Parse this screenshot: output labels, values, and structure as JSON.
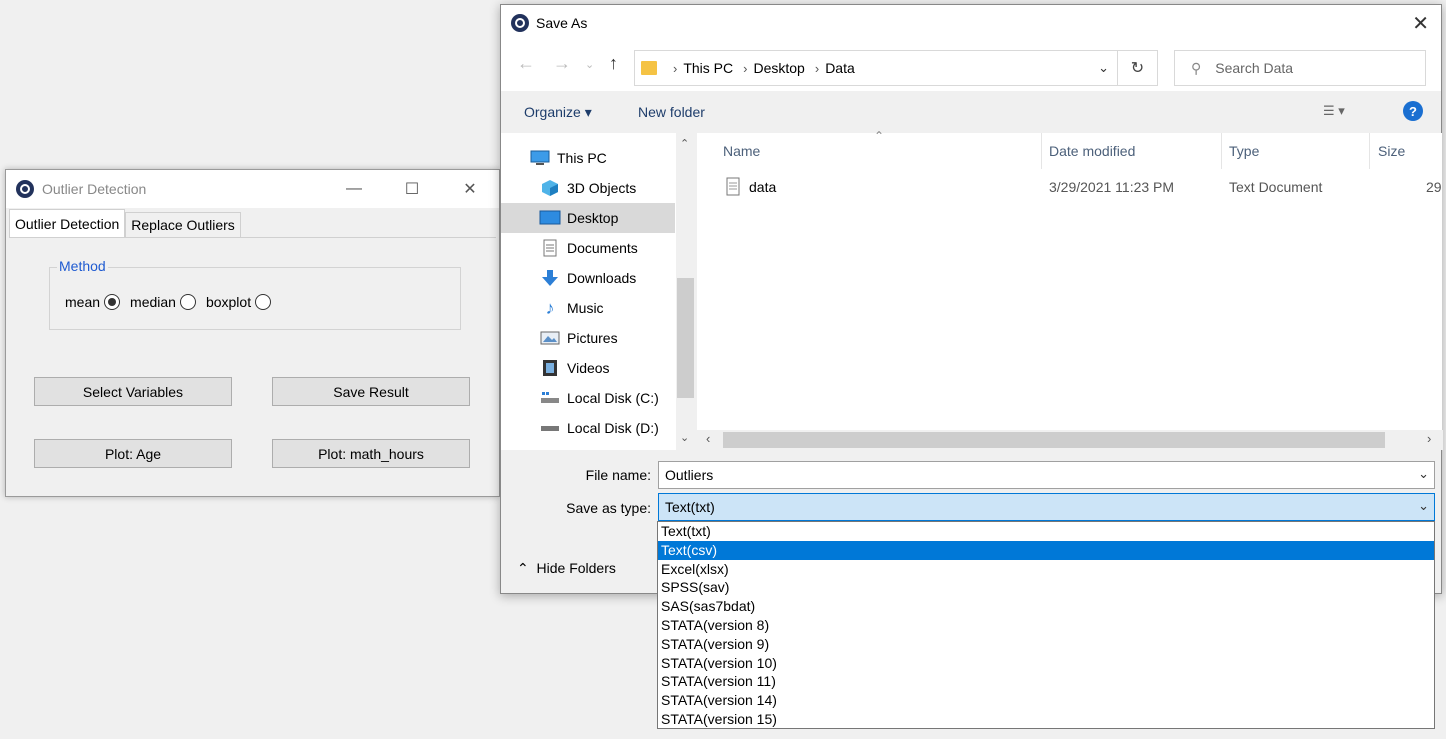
{
  "outlier_window": {
    "title": "Outlier Detection",
    "tabs": [
      "Outlier Detection",
      "Replace Outliers"
    ],
    "method_legend": "Method",
    "radios": [
      {
        "label": "mean",
        "selected": true
      },
      {
        "label": "median",
        "selected": false
      },
      {
        "label": "boxplot",
        "selected": false
      }
    ],
    "buttons": {
      "select_variables": "Select Variables",
      "save_result": "Save Result",
      "plot_age": "Plot: Age",
      "plot_math": "Plot: math_hours"
    }
  },
  "save_dialog": {
    "title": "Save As",
    "breadcrumb": [
      "This PC",
      "Desktop",
      "Data"
    ],
    "search_placeholder": "Search Data",
    "toolbar": {
      "organize": "Organize",
      "new_folder": "New folder"
    },
    "nav_items": [
      "This PC",
      "3D Objects",
      "Desktop",
      "Documents",
      "Downloads",
      "Music",
      "Pictures",
      "Videos",
      "Local Disk (C:)",
      "Local Disk (D:)"
    ],
    "selected_nav": "Desktop",
    "columns": {
      "name": "Name",
      "date": "Date modified",
      "type": "Type",
      "size": "Size"
    },
    "files": [
      {
        "name": "data",
        "date": "3/29/2021 11:23 PM",
        "type": "Text Document",
        "size": "29"
      }
    ],
    "file_name_label": "File name:",
    "file_name_value": "Outliers",
    "save_type_label": "Save as type:",
    "save_type_value": "Text(txt)",
    "hide_folders": "Hide Folders",
    "type_options": [
      "Text(txt)",
      "Text(csv)",
      "Excel(xlsx)",
      "SPSS(sav)",
      "SAS(sas7bdat)",
      "STATA(version 8)",
      "STATA(version 9)",
      "STATA(version 10)",
      "STATA(version 11)",
      "STATA(version 14)",
      "STATA(version 15)"
    ],
    "highlighted_option": "Text(csv)",
    "colors": {
      "accent": "#0078d7",
      "selected_field": "#cce4f7",
      "method_legend": "#1f5bd1"
    }
  }
}
